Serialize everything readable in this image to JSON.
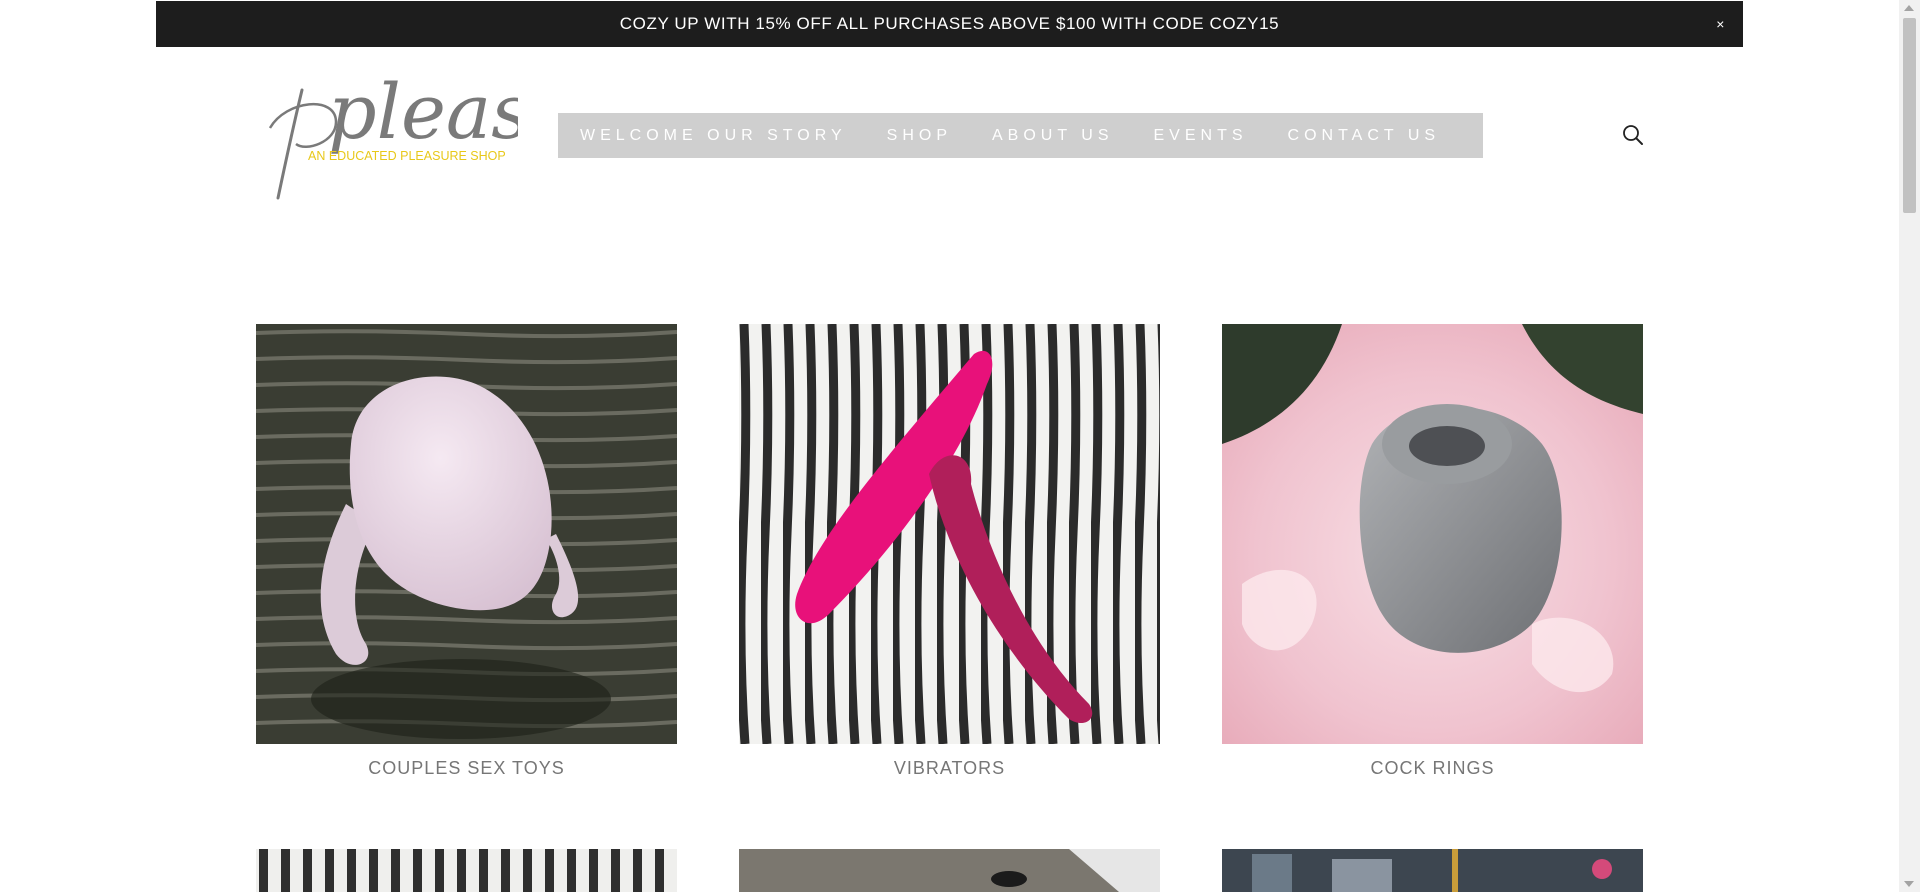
{
  "announcement": {
    "text": "COZY UP WITH 15% OFF ALL PURCHASES ABOVE $100 WITH CODE COZY15",
    "close_label": "×"
  },
  "logo": {
    "wordmark": "please",
    "tagline": "AN EDUCATED PLEASURE SHOP"
  },
  "nav": {
    "items": [
      {
        "label": "WELCOME OUR STORY"
      },
      {
        "label": "SHOP"
      },
      {
        "label": "ABOUT US"
      },
      {
        "label": "EVENTS"
      },
      {
        "label": "CONTACT US"
      }
    ]
  },
  "search": {
    "icon": "search-icon"
  },
  "products": [
    {
      "label": "COUPLES SEX TOYS"
    },
    {
      "label": "VIBRATORS"
    },
    {
      "label": "COCK RINGS"
    }
  ],
  "colors": {
    "announcement_bg": "#1d1d1d",
    "nav_bg": "#cfcfcf",
    "logo_gray": "#7a7a7a",
    "logo_yellow": "#e8c81a",
    "caption": "#767676"
  }
}
